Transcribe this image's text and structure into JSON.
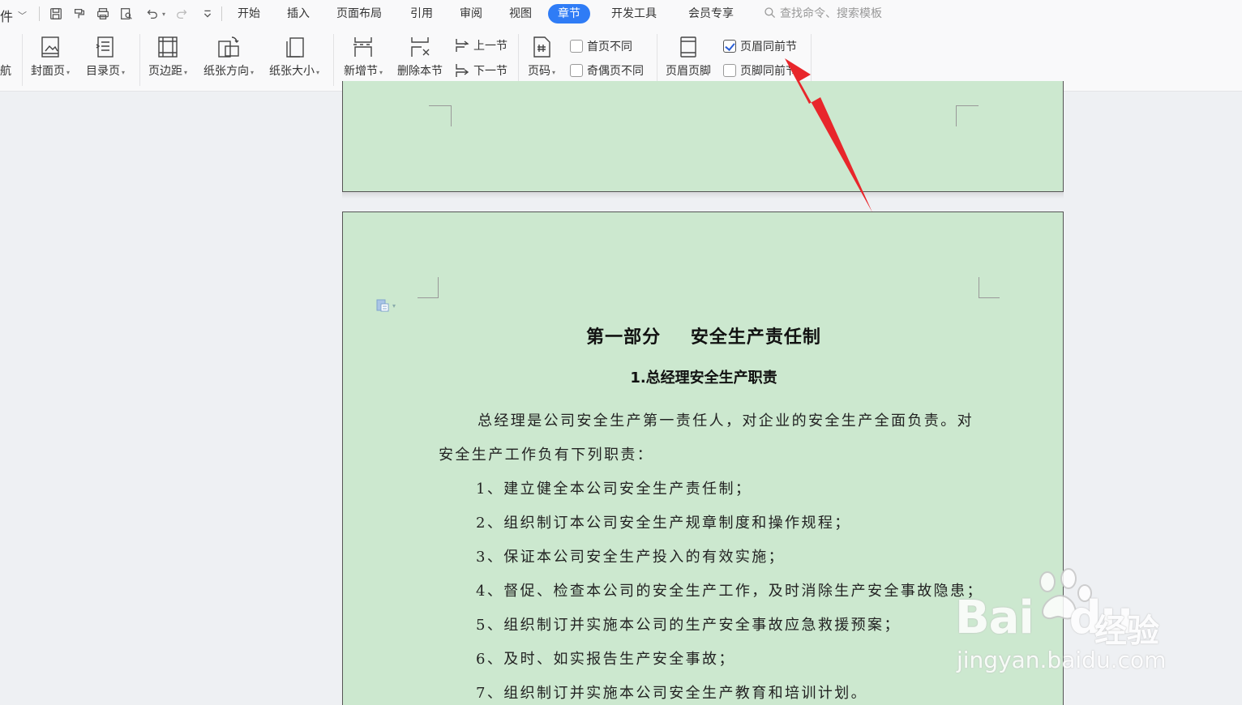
{
  "menu": {
    "file_label": "件",
    "tabs": [
      "开始",
      "插入",
      "页面布局",
      "引用",
      "审阅",
      "视图",
      "章节",
      "开发工具",
      "会员专享"
    ],
    "active_tab": "章节",
    "search_placeholder": "查找命令、搜索模板"
  },
  "ribbon": {
    "nav_partial": "航",
    "cover_page": "封面页",
    "toc_page": "目录页",
    "margins": "页边距",
    "orientation": "纸张方向",
    "paper_size": "纸张大小",
    "new_section": "新增节",
    "delete_section": "删除本节",
    "prev_section": "上一节",
    "next_section": "下一节",
    "page_number": "页码",
    "first_page_diff": "首页不同",
    "odd_even_diff": "奇偶页不同",
    "header_footer": "页眉页脚",
    "header_same_as_prev": "页眉同前节",
    "footer_same_as_prev": "页脚同前节",
    "header_same_checked": true,
    "footer_same_checked": false,
    "first_page_checked": false,
    "odd_even_checked": false
  },
  "document": {
    "title": "第一部分 安全生产责任制",
    "subtitle": "1.总经理安全生产职责",
    "intro_line1": "总经理是公司安全生产第一责任人，对企业的安全生产全面负责。对",
    "intro_line2": "安全生产工作负有下列职责：",
    "items": [
      "1、建立健全本公司安全生产责任制；",
      "2、组织制订本公司安全生产规章制度和操作规程；",
      "3、保证本公司安全生产投入的有效实施；",
      "4、督促、检查本公司的安全生产工作，及时消除生产安全事故隐患；",
      "5、组织制订并实施本公司的生产安全事故应急救援预案；",
      "6、及时、如实报告生产安全事故；",
      "7、组织制订并实施本公司安全生产教育和培训计划。"
    ]
  },
  "watermark": {
    "brand": "Bai",
    "brand2": "du",
    "cn": "经验",
    "url": "jingyan.baidu.com"
  },
  "colors": {
    "accent": "#2f7cf6",
    "page_bg": "#cce8cf",
    "arrow": "#e8262b"
  }
}
